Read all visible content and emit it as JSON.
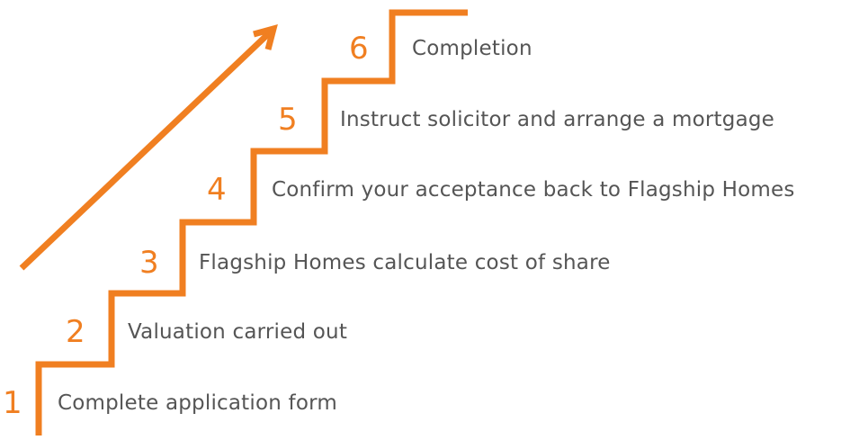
{
  "accent_color": "#f07f21",
  "text_color": "#555555",
  "arrow_icon": "arrow-up-right-icon",
  "steps": [
    {
      "number": "1",
      "label": "Complete application form"
    },
    {
      "number": "2",
      "label": "Valuation carried out"
    },
    {
      "number": "3",
      "label": "Flagship Homes calculate cost of share"
    },
    {
      "number": "4",
      "label": "Confirm your acceptance back to Flagship Homes"
    },
    {
      "number": "5",
      "label": "Instruct solicitor and arrange a mortgage"
    },
    {
      "number": "6",
      "label": "Completion"
    }
  ]
}
